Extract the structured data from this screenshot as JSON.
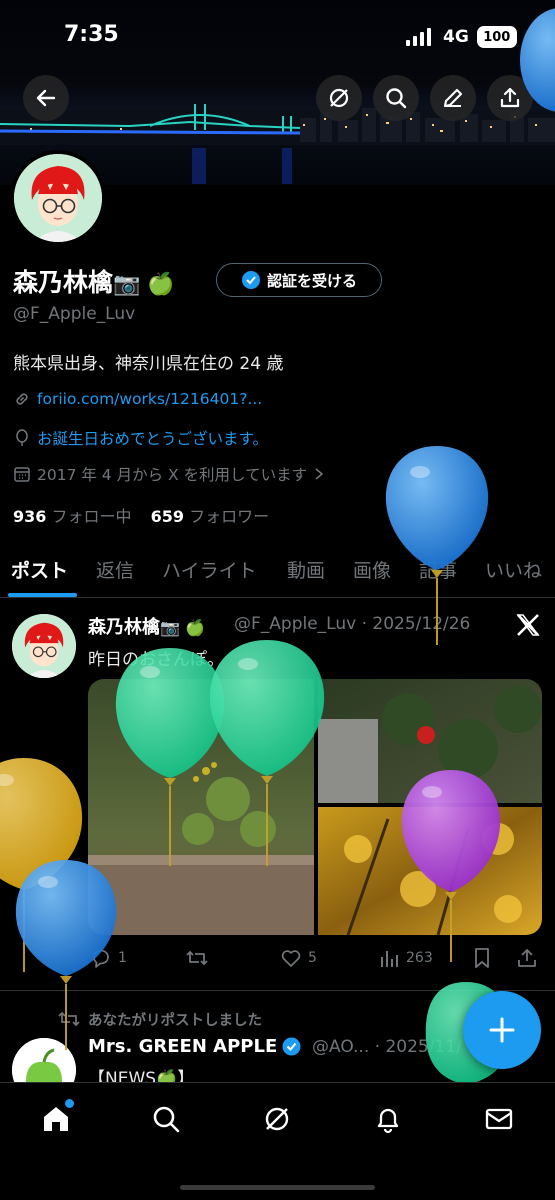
{
  "status_bar": {
    "time": "7:35",
    "network": "4G",
    "battery": "100"
  },
  "header": {
    "back_icon": "arrow-left-icon",
    "actions": [
      "grok-icon",
      "search-icon",
      "edit-icon",
      "share-icon"
    ]
  },
  "profile": {
    "name": "森乃林檎",
    "name_emojis": "📷 🍏",
    "verify_button": "認証を受ける",
    "handle": "@F_Apple_Luv",
    "bio": "熊本県出身、神奈川県在住の 24 歳",
    "website": "foriio.com/works/1216401?...",
    "birthday": "お誕生日おめでとうございます。",
    "joined": "2017 年 4 月から X を利用しています",
    "following_count": "936",
    "following_label": "フォロー中",
    "followers_count": "659",
    "followers_label": "フォロワー"
  },
  "tabs": [
    "ポスト",
    "返信",
    "ハイライト",
    "動画",
    "画像",
    "記事",
    "いいね"
  ],
  "tweets": [
    {
      "name": "森乃林檎",
      "emojis": "📷 🍏",
      "handle": "@F_Apple_Luv · 2025/12/26",
      "text": "昨日のおさんぽ。",
      "replies": "1",
      "likes": "5",
      "views": "263"
    },
    {
      "repost_label": "あなたがリポストしました",
      "name": "Mrs. GREEN APPLE",
      "handle": "@AO... · 2025/11/",
      "text": "【NEWS🍏】"
    }
  ],
  "colors": {
    "accent": "#1d9bf0",
    "background": "#000000",
    "muted": "#71767b"
  }
}
